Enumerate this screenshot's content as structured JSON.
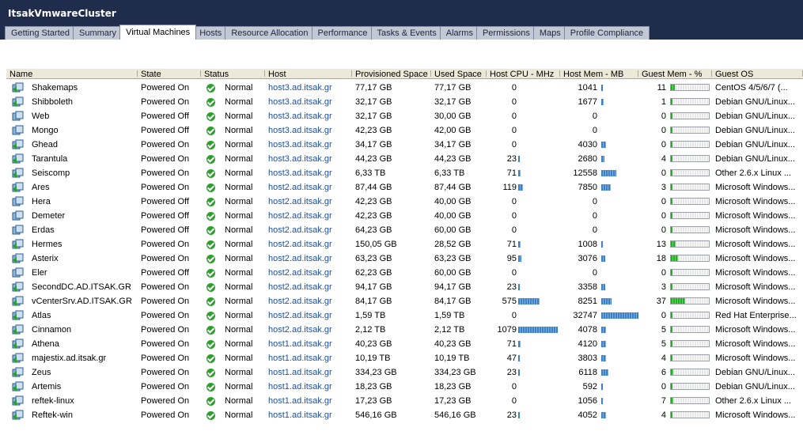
{
  "window": {
    "title": "ItsakVmwareCluster"
  },
  "tabs": [
    {
      "label": "Getting Started",
      "active": false
    },
    {
      "label": "Summary",
      "active": false
    },
    {
      "label": "Virtual Machines",
      "active": true
    },
    {
      "label": "Hosts",
      "active": false
    },
    {
      "label": "Resource Allocation",
      "active": false
    },
    {
      "label": "Performance",
      "active": false
    },
    {
      "label": "Tasks & Events",
      "active": false
    },
    {
      "label": "Alarms",
      "active": false
    },
    {
      "label": "Permissions",
      "active": false
    },
    {
      "label": "Maps",
      "active": false
    },
    {
      "label": "Profile Compliance",
      "active": false
    }
  ],
  "columns": [
    "Name",
    "State",
    "Status",
    "Host",
    "Provisioned Space",
    "Used Space",
    "Host CPU - MHz",
    "Host Mem - MB",
    "Guest Mem - %",
    "Guest OS"
  ],
  "colors": {
    "header_bg": "#1f2c4c",
    "link": "#1d4fa8",
    "status_ok": "#2f9e2f",
    "bar": "#3b7fc6",
    "gauge": "#22b022"
  },
  "rows": [
    {
      "name": "Shakemaps",
      "state": "Powered On",
      "status": "Normal",
      "host": "host3.ad.itsak.gr",
      "prov": "77,17 GB",
      "used": "77,17 GB",
      "cpu": "0",
      "mem": "1041",
      "guest_mem": "11",
      "os": "CentOS 4/5/6/7 (..."
    },
    {
      "name": "Shibboleth",
      "state": "Powered On",
      "status": "Normal",
      "host": "host3.ad.itsak.gr",
      "prov": "32,17 GB",
      "used": "32,17 GB",
      "cpu": "0",
      "mem": "1677",
      "guest_mem": "1",
      "os": "Debian GNU/Linux..."
    },
    {
      "name": "Web",
      "state": "Powered Off",
      "status": "Normal",
      "host": "host3.ad.itsak.gr",
      "prov": "32,17 GB",
      "used": "30,00 GB",
      "cpu": "0",
      "mem": "0",
      "guest_mem": "0",
      "os": "Debian GNU/Linux..."
    },
    {
      "name": "Mongo",
      "state": "Powered Off",
      "status": "Normal",
      "host": "host3.ad.itsak.gr",
      "prov": "42,23 GB",
      "used": "42,00 GB",
      "cpu": "0",
      "mem": "0",
      "guest_mem": "0",
      "os": "Debian GNU/Linux..."
    },
    {
      "name": "Ghead",
      "state": "Powered On",
      "status": "Normal",
      "host": "host3.ad.itsak.gr",
      "prov": "34,17 GB",
      "used": "34,17 GB",
      "cpu": "0",
      "mem": "4030",
      "guest_mem": "0",
      "os": "Debian GNU/Linux..."
    },
    {
      "name": "Tarantula",
      "state": "Powered On",
      "status": "Normal",
      "host": "host3.ad.itsak.gr",
      "prov": "44,23 GB",
      "used": "44,23 GB",
      "cpu": "23",
      "mem": "2680",
      "guest_mem": "4",
      "os": "Debian GNU/Linux..."
    },
    {
      "name": "Seiscomp",
      "state": "Powered On",
      "status": "Normal",
      "host": "host3.ad.itsak.gr",
      "prov": "6,33 TB",
      "used": "6,33 TB",
      "cpu": "71",
      "mem": "12558",
      "guest_mem": "0",
      "os": "Other 2.6.x Linux ..."
    },
    {
      "name": "Ares",
      "state": "Powered On",
      "status": "Normal",
      "host": "host2.ad.itsak.gr",
      "prov": "87,44 GB",
      "used": "87,44 GB",
      "cpu": "119",
      "mem": "7850",
      "guest_mem": "3",
      "os": "Microsoft Windows..."
    },
    {
      "name": "Hera",
      "state": "Powered Off",
      "status": "Normal",
      "host": "host2.ad.itsak.gr",
      "prov": "42,23 GB",
      "used": "40,00 GB",
      "cpu": "0",
      "mem": "0",
      "guest_mem": "0",
      "os": "Microsoft Windows..."
    },
    {
      "name": "Demeter",
      "state": "Powered Off",
      "status": "Normal",
      "host": "host2.ad.itsak.gr",
      "prov": "42,23 GB",
      "used": "40,00 GB",
      "cpu": "0",
      "mem": "0",
      "guest_mem": "0",
      "os": "Microsoft Windows..."
    },
    {
      "name": "Erdas",
      "state": "Powered Off",
      "status": "Normal",
      "host": "host2.ad.itsak.gr",
      "prov": "64,23 GB",
      "used": "60,00 GB",
      "cpu": "0",
      "mem": "0",
      "guest_mem": "0",
      "os": "Microsoft Windows..."
    },
    {
      "name": "Hermes",
      "state": "Powered On",
      "status": "Normal",
      "host": "host2.ad.itsak.gr",
      "prov": "150,05 GB",
      "used": "28,52 GB",
      "cpu": "71",
      "mem": "1008",
      "guest_mem": "13",
      "os": "Microsoft Windows..."
    },
    {
      "name": "Asterix",
      "state": "Powered On",
      "status": "Normal",
      "host": "host2.ad.itsak.gr",
      "prov": "63,23 GB",
      "used": "63,23 GB",
      "cpu": "95",
      "mem": "3076",
      "guest_mem": "18",
      "os": "Microsoft Windows..."
    },
    {
      "name": "Eler",
      "state": "Powered Off",
      "status": "Normal",
      "host": "host2.ad.itsak.gr",
      "prov": "62,23 GB",
      "used": "60,00 GB",
      "cpu": "0",
      "mem": "0",
      "guest_mem": "0",
      "os": "Microsoft Windows..."
    },
    {
      "name": "SecondDC.AD.ITSAK.GR",
      "state": "Powered On",
      "status": "Normal",
      "host": "host2.ad.itsak.gr",
      "prov": "94,17 GB",
      "used": "94,17 GB",
      "cpu": "23",
      "mem": "3358",
      "guest_mem": "3",
      "os": "Microsoft Windows..."
    },
    {
      "name": "vCenterSrv.AD.ITSAK.GR",
      "state": "Powered On",
      "status": "Normal",
      "host": "host2.ad.itsak.gr",
      "prov": "84,17 GB",
      "used": "84,17 GB",
      "cpu": "575",
      "mem": "8251",
      "guest_mem": "37",
      "os": "Microsoft Windows..."
    },
    {
      "name": "Atlas",
      "state": "Powered On",
      "status": "Normal",
      "host": "host2.ad.itsak.gr",
      "prov": "1,59 TB",
      "used": "1,59 TB",
      "cpu": "0",
      "mem": "32747",
      "guest_mem": "0",
      "os": "Red Hat Enterprise..."
    },
    {
      "name": "Cinnamon",
      "state": "Powered On",
      "status": "Normal",
      "host": "host2.ad.itsak.gr",
      "prov": "2,12 TB",
      "used": "2,12 TB",
      "cpu": "1079",
      "mem": "4078",
      "guest_mem": "5",
      "os": "Microsoft Windows..."
    },
    {
      "name": "Athena",
      "state": "Powered On",
      "status": "Normal",
      "host": "host1.ad.itsak.gr",
      "prov": "40,23 GB",
      "used": "40,23 GB",
      "cpu": "71",
      "mem": "4120",
      "guest_mem": "5",
      "os": "Microsoft Windows..."
    },
    {
      "name": "majestix.ad.itsak.gr",
      "state": "Powered On",
      "status": "Normal",
      "host": "host1.ad.itsak.gr",
      "prov": "10,19 TB",
      "used": "10,19 TB",
      "cpu": "47",
      "mem": "3803",
      "guest_mem": "4",
      "os": "Microsoft Windows..."
    },
    {
      "name": "Zeus",
      "state": "Powered On",
      "status": "Normal",
      "host": "host1.ad.itsak.gr",
      "prov": "334,23 GB",
      "used": "334,23 GB",
      "cpu": "23",
      "mem": "6118",
      "guest_mem": "6",
      "os": "Debian GNU/Linux..."
    },
    {
      "name": "Artemis",
      "state": "Powered On",
      "status": "Normal",
      "host": "host1.ad.itsak.gr",
      "prov": "18,23 GB",
      "used": "18,23 GB",
      "cpu": "0",
      "mem": "592",
      "guest_mem": "0",
      "os": "Debian GNU/Linux..."
    },
    {
      "name": "reftek-linux",
      "state": "Powered On",
      "status": "Normal",
      "host": "host1.ad.itsak.gr",
      "prov": "17,23 GB",
      "used": "17,23 GB",
      "cpu": "0",
      "mem": "1056",
      "guest_mem": "7",
      "os": "Other 2.6.x Linux ..."
    },
    {
      "name": "Reftek-win",
      "state": "Powered On",
      "status": "Normal",
      "host": "host1.ad.itsak.gr",
      "prov": "546,16 GB",
      "used": "546,16 GB",
      "cpu": "23",
      "mem": "4052",
      "guest_mem": "4",
      "os": "Microsoft Windows..."
    }
  ]
}
